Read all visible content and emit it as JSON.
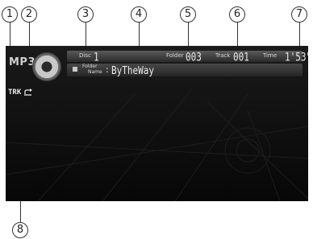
{
  "callouts": [
    "1",
    "2",
    "3",
    "4",
    "5",
    "6",
    "7",
    "8"
  ],
  "display": {
    "source_label": "MP3",
    "disc_label": "Disc",
    "disc_value": "1",
    "folder_label": "Folder",
    "folder_value": "003",
    "track_label": "Track",
    "track_value": "001",
    "time_label": "Time",
    "time_value": "1'53\"",
    "folder_name_label_1": "Folder",
    "folder_name_label_2": "Name",
    "folder_name_colon": ":",
    "folder_name_value": "ByTheWay",
    "repeat_mode": "TRK",
    "repeat_icon": "repeat-arrow-icon"
  }
}
